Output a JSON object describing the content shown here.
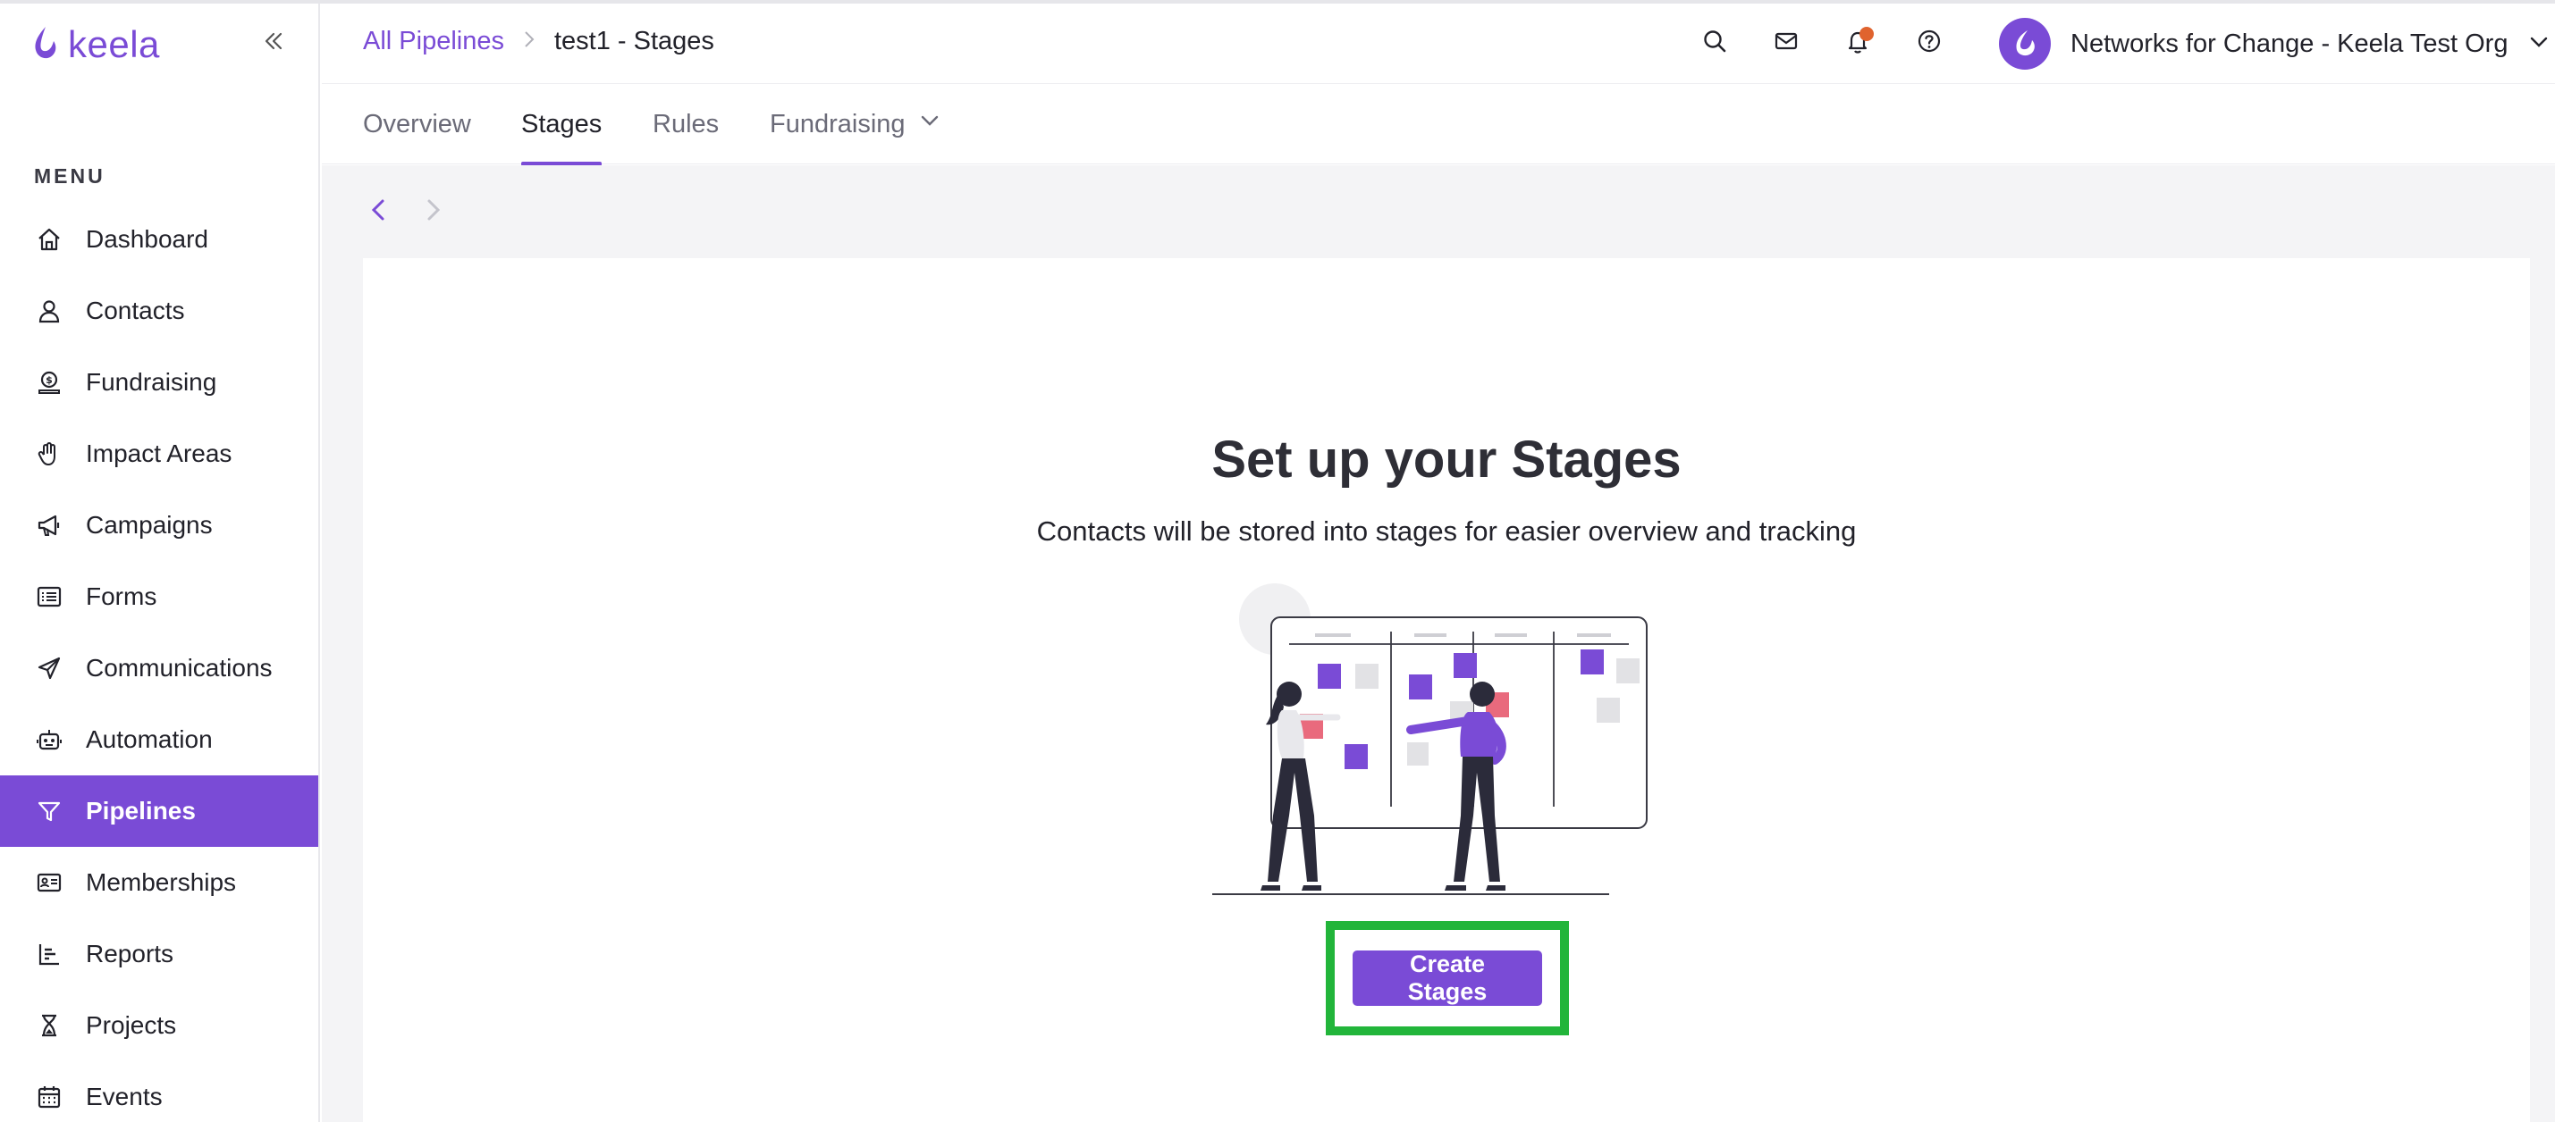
{
  "app": {
    "logo_text": "keela",
    "brand_color": "#7a4bd6",
    "highlight_color": "#22b53a"
  },
  "sidebar": {
    "menu_label": "MENU",
    "items": [
      {
        "label": "Dashboard",
        "icon": "home-icon"
      },
      {
        "label": "Contacts",
        "icon": "person-icon"
      },
      {
        "label": "Fundraising",
        "icon": "money-icon"
      },
      {
        "label": "Impact Areas",
        "icon": "hand-icon"
      },
      {
        "label": "Campaigns",
        "icon": "megaphone-icon"
      },
      {
        "label": "Forms",
        "icon": "list-icon"
      },
      {
        "label": "Communications",
        "icon": "paper-plane-icon"
      },
      {
        "label": "Automation",
        "icon": "robot-icon"
      },
      {
        "label": "Pipelines",
        "icon": "filter-icon",
        "active": true
      },
      {
        "label": "Memberships",
        "icon": "id-card-icon"
      },
      {
        "label": "Reports",
        "icon": "bar-chart-icon"
      },
      {
        "label": "Projects",
        "icon": "hourglass-icon"
      },
      {
        "label": "Events",
        "icon": "calendar-icon"
      }
    ]
  },
  "header": {
    "breadcrumb_root": "All Pipelines",
    "breadcrumb_current": "test1 - Stages",
    "org_name": "Networks for Change - Keela Test Org",
    "icons": [
      "search-icon",
      "mail-icon",
      "bell-icon",
      "help-icon"
    ]
  },
  "tabs": [
    {
      "label": "Overview"
    },
    {
      "label": "Stages",
      "active": true
    },
    {
      "label": "Rules"
    },
    {
      "label": "Fundraising",
      "dropdown": true
    }
  ],
  "empty_state": {
    "title": "Set up your Stages",
    "subtitle": "Contacts will be stored into stages for easier overview and tracking",
    "button_label": "Create Stages"
  }
}
